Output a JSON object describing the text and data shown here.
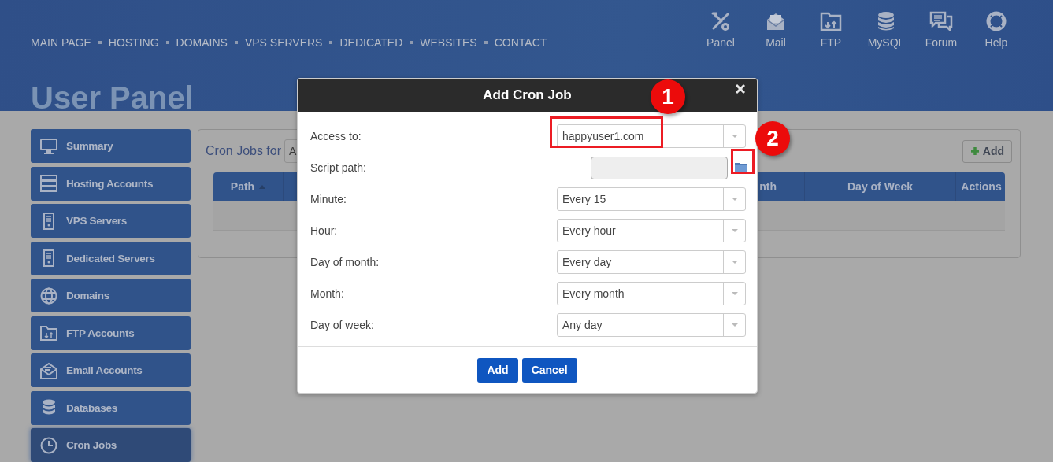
{
  "header": {
    "nav": [
      "MAIN PAGE",
      "HOSTING",
      "DOMAINS",
      "VPS SERVERS",
      "DEDICATED",
      "WEBSITES",
      "CONTACT"
    ],
    "shortcuts": [
      {
        "label": "Panel"
      },
      {
        "label": "Mail"
      },
      {
        "label": "FTP"
      },
      {
        "label": "MySQL"
      },
      {
        "label": "Forum"
      },
      {
        "label": "Help"
      }
    ]
  },
  "page_title": "User Panel",
  "sidebar": {
    "items": [
      {
        "label": "Summary",
        "selected": false
      },
      {
        "label": "Hosting Accounts",
        "selected": false
      },
      {
        "label": "VPS Servers",
        "selected": false
      },
      {
        "label": "Dedicated Servers",
        "selected": false
      },
      {
        "label": "Domains",
        "selected": false
      },
      {
        "label": "FTP Accounts",
        "selected": false
      },
      {
        "label": "Email Accounts",
        "selected": false
      },
      {
        "label": "Databases",
        "selected": false
      },
      {
        "label": "Cron Jobs",
        "selected": true
      }
    ]
  },
  "panel": {
    "title": "Cron Jobs for",
    "filter_value": "A",
    "add_button": "Add",
    "table": {
      "columns": [
        {
          "label": "Path",
          "sorted": true
        },
        {
          "label": "nth",
          "sorted": false
        },
        {
          "label": "Day of Week",
          "sorted": false
        },
        {
          "label": "Actions",
          "sorted": false
        }
      ]
    }
  },
  "dialog": {
    "title": "Add Cron Job",
    "fields": [
      {
        "label": "Access to:",
        "kind": "select",
        "value": "happyuser1.com"
      },
      {
        "label": "Script path:",
        "kind": "path"
      },
      {
        "label": "Minute:",
        "kind": "select",
        "value": "Every 15"
      },
      {
        "label": "Hour:",
        "kind": "select",
        "value": "Every hour"
      },
      {
        "label": "Day of month:",
        "kind": "select",
        "value": "Every day"
      },
      {
        "label": "Month:",
        "kind": "select",
        "value": "Every month"
      },
      {
        "label": "Day of week:",
        "kind": "select",
        "value": "Any day"
      }
    ],
    "buttons": [
      "Add",
      "Cancel"
    ]
  },
  "callouts": [
    {
      "number": "1"
    },
    {
      "number": "2"
    }
  ]
}
